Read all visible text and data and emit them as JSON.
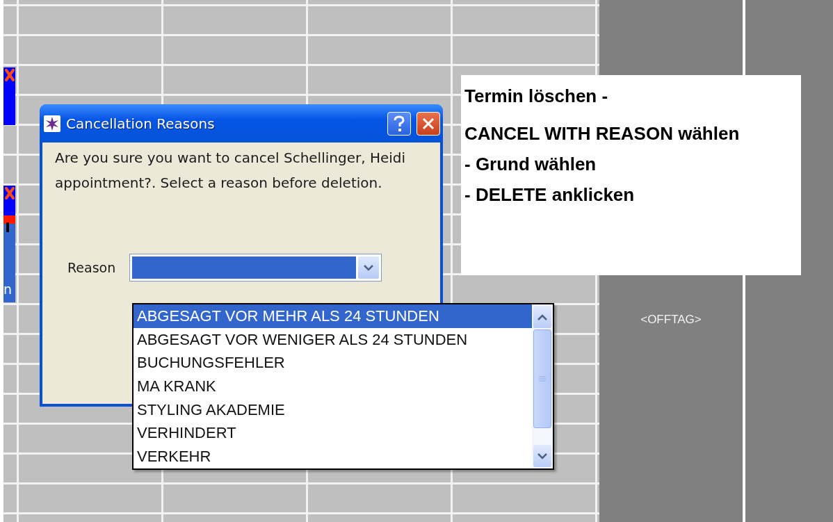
{
  "schedule": {
    "appointments": [
      {
        "kind": "cancelled"
      },
      {
        "kind": "cancelled"
      },
      {
        "kind": "booked",
        "text": "n"
      }
    ],
    "offday_label": "<OFFTAG>"
  },
  "dialog": {
    "title": "Cancellation Reasons",
    "message": "Are you sure you want to cancel Schellinger, Heidi appointment?. Select a reason before deletion.",
    "reason_label": "Reason",
    "options": [
      {
        "label": "ABGESAGT VOR MEHR ALS 24 STUNDEN",
        "selected": true
      },
      {
        "label": "ABGESAGT VOR WENIGER ALS 24 STUNDEN",
        "selected": false
      },
      {
        "label": "BUCHUNGSFEHLER",
        "selected": false
      },
      {
        "label": "MA KRANK",
        "selected": false
      },
      {
        "label": "STYLING AKADEMIE",
        "selected": false
      },
      {
        "label": "VERHINDERT",
        "selected": false
      },
      {
        "label": "VERKEHR",
        "selected": false
      }
    ]
  },
  "note": {
    "lines": [
      "Termin löschen -",
      "CANCEL WITH REASON wählen",
      "- Grund wählen",
      "- DELETE anklicken"
    ]
  }
}
